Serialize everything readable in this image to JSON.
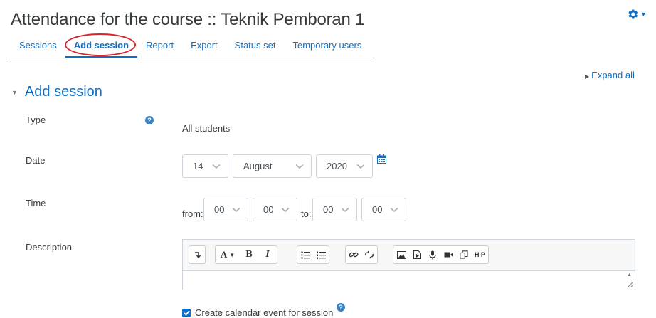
{
  "page": {
    "title": "Attendance for the course :: Teknik Pemboran 1",
    "settings_icon": "gear-icon",
    "accent_color": "#0f6fc5",
    "highlight_color": "#d8242b"
  },
  "tabs": [
    {
      "label": "Sessions",
      "active": false
    },
    {
      "label": "Add session",
      "active": true
    },
    {
      "label": "Report",
      "active": false
    },
    {
      "label": "Export",
      "active": false
    },
    {
      "label": "Status set",
      "active": false
    },
    {
      "label": "Temporary users",
      "active": false
    }
  ],
  "expand_all": "Expand all",
  "section_title": "Add session",
  "form": {
    "type": {
      "label": "Type",
      "value": "All students",
      "help_icon": "question-circle-icon"
    },
    "date": {
      "label": "Date",
      "day": "14",
      "month": "August",
      "year": "2020",
      "calendar_icon": "calendar-icon"
    },
    "time": {
      "label": "Time",
      "from_label": "from:",
      "to_label": "to:",
      "from_hour": "00",
      "from_minute": "00",
      "to_hour": "00",
      "to_minute": "00"
    },
    "description": {
      "label": "Description",
      "value": ""
    },
    "calendar_event": {
      "label": "Create calendar event for session",
      "checked": true,
      "help_icon": "question-circle-icon"
    }
  },
  "editor": {
    "toolbar_text": {
      "bold": "B",
      "italic": "I",
      "font": "A",
      "h5p": "H-P"
    },
    "toolbar_icons": [
      "collapse-icon",
      "font-icon",
      "bold-icon",
      "italic-icon",
      "unordered-list-icon",
      "ordered-list-icon",
      "link-icon",
      "unlink-icon",
      "image-icon",
      "media-icon",
      "record-audio-icon",
      "record-video-icon",
      "manage-files-icon",
      "h5p-icon"
    ]
  }
}
